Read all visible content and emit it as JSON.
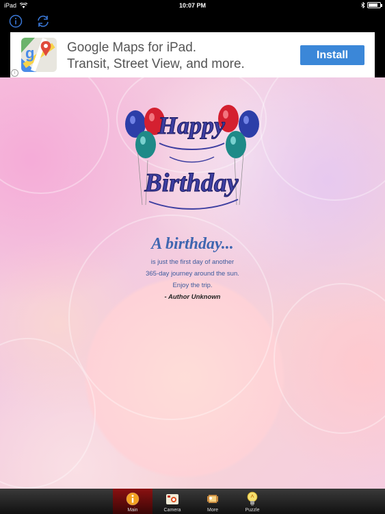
{
  "status_bar": {
    "carrier": "iPad",
    "time": "10:07 PM"
  },
  "nav": {
    "info_icon": "info-icon",
    "refresh_icon": "refresh-icon"
  },
  "ad": {
    "line1": "Google Maps for iPad.",
    "line2": "Transit, Street View, and more.",
    "install_label": "Install",
    "info_label": "i"
  },
  "content": {
    "logo_top": "Happy",
    "logo_bottom": "Birthday",
    "quote_title": "A birthday...",
    "quote_lines": [
      "is just the first day of another",
      "365-day journey around the sun.",
      "Enjoy the trip."
    ],
    "author": "- Author Unknown"
  },
  "tabs": [
    {
      "label": "Main",
      "icon": "info-icon",
      "active": true
    },
    {
      "label": "Camera",
      "icon": "camera-icon",
      "active": false
    },
    {
      "label": "More",
      "icon": "film-icon",
      "active": false
    },
    {
      "label": "Puzzle",
      "icon": "lightbulb-icon",
      "active": false
    }
  ],
  "colors": {
    "accent": "#3b87d8",
    "quote_blue": "#3f66b0",
    "tab_active": "#8a1111"
  }
}
